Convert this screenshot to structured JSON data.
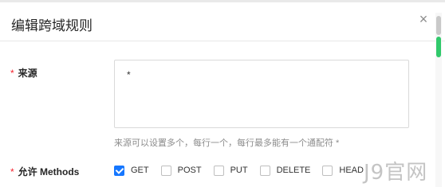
{
  "dialog": {
    "title": "编辑跨域规则",
    "close_glyph": "×"
  },
  "form": {
    "required_mark": "*",
    "origin": {
      "label": "来源",
      "value": "*",
      "hint": "来源可以设置多个，每行一个，每行最多能有一个通配符 *"
    },
    "methods": {
      "label": "允许 Methods",
      "options": [
        {
          "label": "GET",
          "checked": true
        },
        {
          "label": "POST",
          "checked": false
        },
        {
          "label": "PUT",
          "checked": false
        },
        {
          "label": "DELETE",
          "checked": false
        },
        {
          "label": "HEAD",
          "checked": false
        }
      ]
    }
  },
  "watermark": "J9官网",
  "colors": {
    "accent": "#1677ff",
    "required": "#f5222d",
    "scroll_highlight": "#31c96b"
  }
}
